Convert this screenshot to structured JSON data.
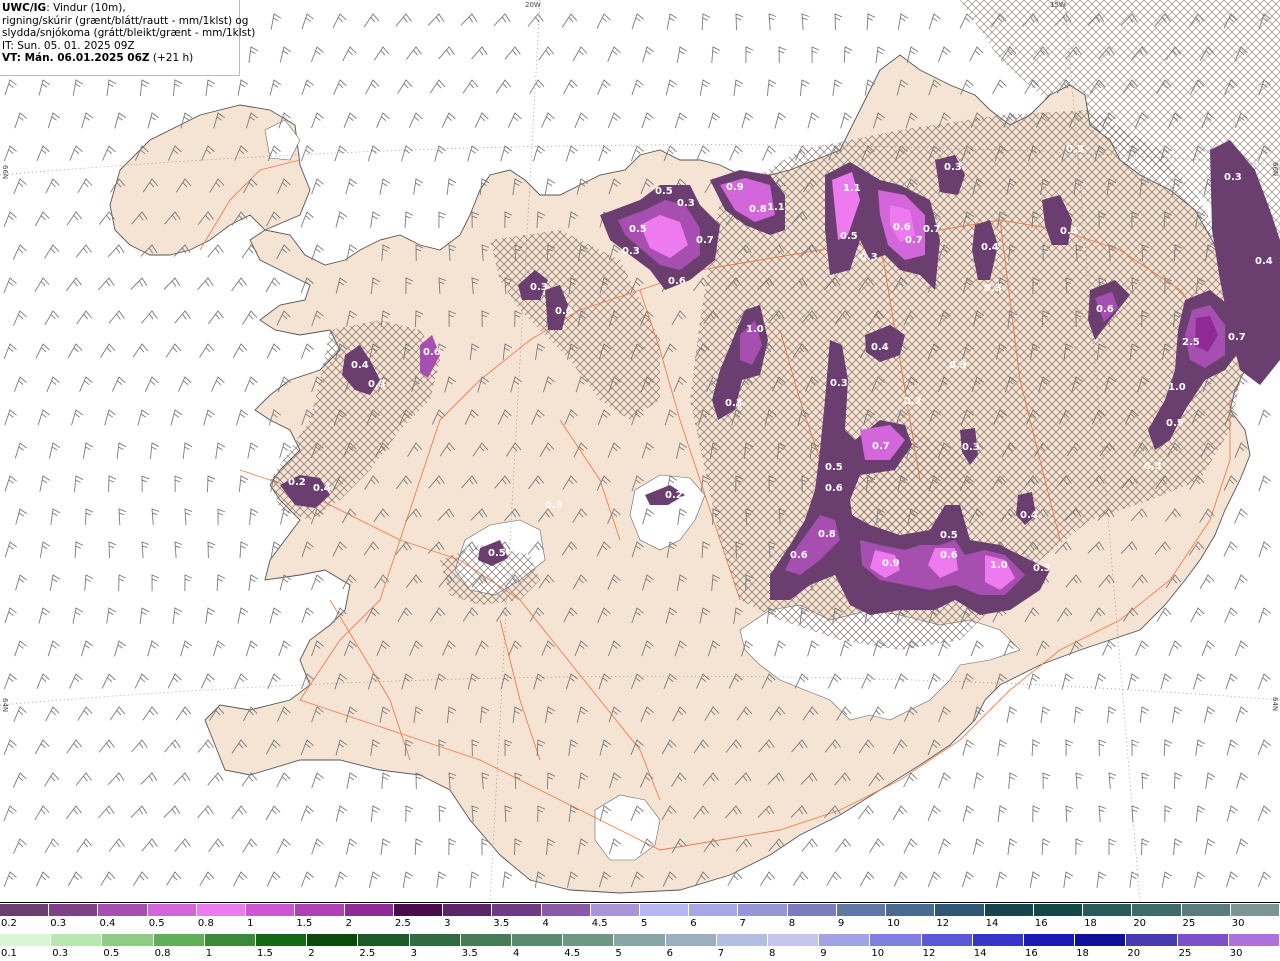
{
  "header": {
    "model": "UWC/IG",
    "line1": ": Vindur (10m),",
    "line2": "rigning/skúrir (grænt/blátt/rautt - mm/1klst) og",
    "line3": "slydda/snjókoma (grátt/bleikt/grænt - mm/1klst)",
    "issue_time": "IT: Sun. 05. 01. 2025 09Z",
    "valid_time": "VT: Mán. 06.01.2025 06Z",
    "lead": " (+21 h)"
  },
  "axis_labels": {
    "top_20w": "20W",
    "top_15w": "15W",
    "left_66n": "66N",
    "left_64n": "64N",
    "right_66n": "66N",
    "right_64n": "64N"
  },
  "precip_values": [
    {
      "label": "0.5",
      "name": "value-05-a"
    },
    {
      "label": "0.3",
      "name": "value-03-a"
    },
    {
      "label": "0.9",
      "name": "value-09-a"
    },
    {
      "label": "0.8",
      "name": "value-08-a"
    },
    {
      "label": "1.1",
      "name": "value-11-a"
    },
    {
      "label": "0.5",
      "name": "value-05-b"
    },
    {
      "label": "0.7",
      "name": "value-07-a"
    },
    {
      "label": "0.3",
      "name": "value-03-b"
    },
    {
      "label": "0.6",
      "name": "value-06-a"
    },
    {
      "label": "1.1",
      "name": "value-11-b"
    },
    {
      "label": "0.5",
      "name": "value-05-c"
    },
    {
      "label": "0.6",
      "name": "value-06-b"
    },
    {
      "label": "0.7",
      "name": "value-07-b"
    },
    {
      "label": "0.7",
      "name": "value-07-c"
    },
    {
      "label": "0.3",
      "name": "value-03-c"
    },
    {
      "label": "0.4",
      "name": "value-04-a"
    },
    {
      "label": "0.4",
      "name": "value-04-b"
    },
    {
      "label": "0.3",
      "name": "value-03-d"
    },
    {
      "label": "0.4",
      "name": "value-04-c"
    },
    {
      "label": "0.3",
      "name": "value-03-e"
    },
    {
      "label": "0.6",
      "name": "value-06-c"
    },
    {
      "label": "0.6",
      "name": "value-06-d"
    },
    {
      "label": "0.4",
      "name": "value-04-d"
    },
    {
      "label": "0.3",
      "name": "value-03-f"
    },
    {
      "label": "0.6",
      "name": "value-06-e"
    },
    {
      "label": "1.0",
      "name": "value-10-a"
    },
    {
      "label": "0.3",
      "name": "value-03-g"
    },
    {
      "label": "0.4",
      "name": "value-04-e"
    },
    {
      "label": "0.3",
      "name": "value-03-h"
    },
    {
      "label": "0.3",
      "name": "value-03-i"
    },
    {
      "label": "0.2",
      "name": "value-02-a"
    },
    {
      "label": "0.3",
      "name": "value-03-j"
    },
    {
      "label": "0.7",
      "name": "value-07-d"
    },
    {
      "label": "0.5",
      "name": "value-05-d"
    },
    {
      "label": "0.6",
      "name": "value-06-f"
    },
    {
      "label": "0.8",
      "name": "value-08-b"
    },
    {
      "label": "0.6",
      "name": "value-06-g"
    },
    {
      "label": "0.9",
      "name": "value-09-b"
    },
    {
      "label": "0.5",
      "name": "value-05-e"
    },
    {
      "label": "0.6",
      "name": "value-06-h"
    },
    {
      "label": "1.0",
      "name": "value-10-b"
    },
    {
      "label": "0.3",
      "name": "value-03-k"
    },
    {
      "label": "0.4",
      "name": "value-04-f"
    },
    {
      "label": "0.3",
      "name": "value-03-l"
    },
    {
      "label": "0.4",
      "name": "value-04-g"
    },
    {
      "label": "0.2",
      "name": "value-02-b"
    },
    {
      "label": "0.5",
      "name": "value-05-f"
    },
    {
      "label": "0.3",
      "name": "value-03-m"
    },
    {
      "label": "0.4",
      "name": "value-04-h"
    },
    {
      "label": "0.6",
      "name": "value-06-i"
    },
    {
      "label": "2.5",
      "name": "value-25"
    },
    {
      "label": "0.7",
      "name": "value-07-e"
    },
    {
      "label": "1.0",
      "name": "value-10-c"
    },
    {
      "label": "0.5",
      "name": "value-05-g"
    },
    {
      "label": "0.3",
      "name": "value-03-n"
    },
    {
      "label": "0.2",
      "name": "value-02-c"
    },
    {
      "label": "0.3",
      "name": "value-03-o"
    },
    {
      "label": "0.3",
      "name": "value-03-p"
    }
  ],
  "legend": {
    "snow_colors": [
      "#6a3f70",
      "#7f4186",
      "#a64fb0",
      "#d466dc",
      "#ee7af0",
      "#cd56d4",
      "#b13fb6",
      "#8f2a96",
      "#4a0a4e",
      "#5c2469",
      "#6e3a82",
      "#8a5aa8",
      "#a994d6",
      "#b6b6f0",
      "#a8a8e6",
      "#9696d6",
      "#7b7bbe",
      "#6078a6",
      "#4a6a92",
      "#2f5775",
      "#17434f",
      "#134846",
      "#295a5a",
      "#3e6a6a",
      "#5a7c7c",
      "#7a9696",
      "#a6baba",
      "#d4e0e0"
    ],
    "snow_ticks": [
      "0.2",
      "0.3",
      "0.4",
      "0.5",
      "0.8",
      "1",
      "1.5",
      "2",
      "2.5",
      "3",
      "3.5",
      "4",
      "4.5",
      "5",
      "6",
      "7",
      "8",
      "9",
      "10",
      "12",
      "14",
      "16",
      "18",
      "20",
      "25",
      "30"
    ],
    "rain_colors": [
      "#d9f5d3",
      "#b8e8b0",
      "#8ccd83",
      "#5fae58",
      "#3a8a38",
      "#136a12",
      "#0a4a0a",
      "#1c5a28",
      "#2f6b3e",
      "#477c56",
      "#5b8a70",
      "#6e9884",
      "#88a6a6",
      "#9caec2",
      "#b3bee0",
      "#c4c6ef",
      "#a2a2e6",
      "#7f7fe0",
      "#5a5ad6",
      "#3636c8",
      "#1a1ab4",
      "#0f0f9a",
      "#4a3ab0",
      "#7c50c8",
      "#ad70dc",
      "#db96ec",
      "#f6b4e8",
      "#f49cc8",
      "#ee7ca6",
      "#e8587c",
      "#ee3040",
      "#ff0000"
    ],
    "rain_ticks": [
      "0.1",
      "0.3",
      "0.5",
      "0.8",
      "1",
      "1.5",
      "2",
      "2.5",
      "3",
      "3.5",
      "4",
      "4.5",
      "5",
      "6",
      "7",
      "8",
      "9",
      "10",
      "12",
      "14",
      "16",
      "18",
      "20",
      "25",
      "30"
    ]
  }
}
